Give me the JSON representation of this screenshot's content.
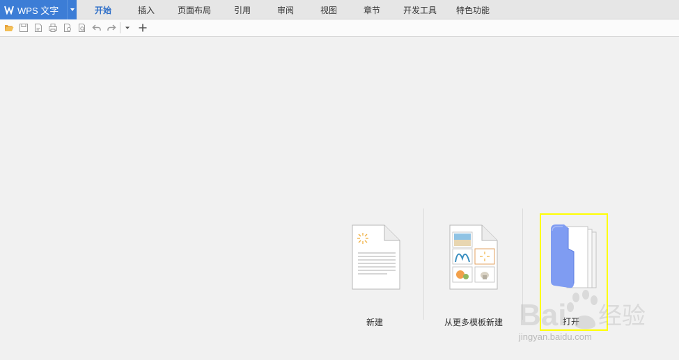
{
  "app": {
    "title": "WPS 文字"
  },
  "menu_tabs": [
    {
      "label": "开始",
      "active": true
    },
    {
      "label": "插入",
      "active": false
    },
    {
      "label": "页面布局",
      "active": false
    },
    {
      "label": "引用",
      "active": false
    },
    {
      "label": "审阅",
      "active": false
    },
    {
      "label": "视图",
      "active": false
    },
    {
      "label": "章节",
      "active": false
    },
    {
      "label": "开发工具",
      "active": false
    },
    {
      "label": "特色功能",
      "active": false
    }
  ],
  "toolbar": {
    "icons": [
      "open-folder-icon",
      "save-icon",
      "export-pdf-icon",
      "print-icon",
      "print-preview-icon",
      "find-icon",
      "undo-icon",
      "redo-icon",
      "customize-dropdown-icon",
      "new-tab-plus-icon"
    ]
  },
  "actions": {
    "new_label": "新建",
    "template_label": "从更多模板新建",
    "open_label": "打开"
  },
  "watermark": {
    "brand_left": "Bai",
    "brand_right": "经验",
    "url": "jingyan.baidu.com"
  },
  "colors": {
    "accent": "#3c7dd6",
    "active_tab": "#2f6fc8",
    "highlight": "#ffff00",
    "folder": "#7f9cf2"
  }
}
